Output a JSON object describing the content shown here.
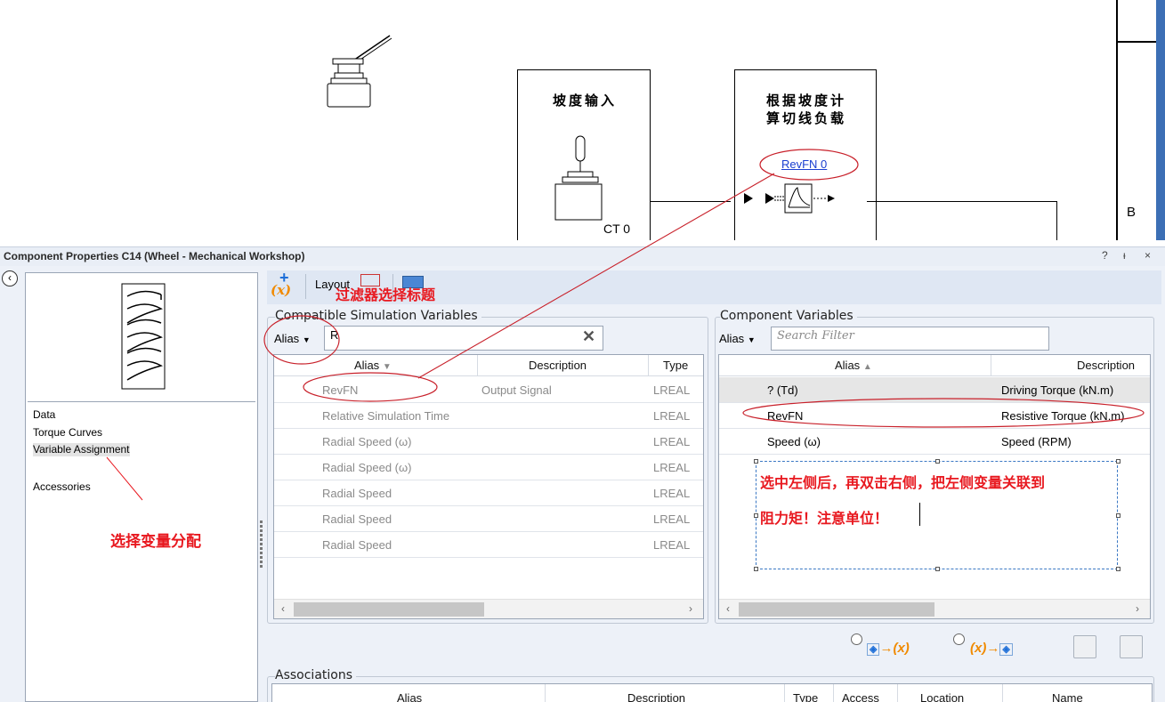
{
  "canvas": {
    "block1": {
      "title": "坡度输入",
      "label": "CT 0"
    },
    "block2": {
      "title_line1": "根据坡度计",
      "title_line2": "算切线负载",
      "link": "RevFN 0"
    },
    "edge_label": "B"
  },
  "window": {
    "title": "Component Properties C14 (Wheel - Mechanical Workshop)",
    "help": "?",
    "pin": "ᵻ",
    "close": "×"
  },
  "nav": {
    "items": [
      {
        "label": "Data"
      },
      {
        "label": "Torque Curves"
      },
      {
        "label": "Variable Assignment",
        "selected": true
      },
      {
        "label": "Accessories"
      }
    ]
  },
  "toolbar": {
    "add_variable_icon": "(x)",
    "layout_label": "Layout"
  },
  "compatible": {
    "group_title": "Compatible Simulation Variables",
    "filter_mode": "Alias",
    "filter_value": "R",
    "columns": {
      "alias": "Alias",
      "description": "Description",
      "type": "Type"
    },
    "rows": [
      {
        "alias": "RevFN",
        "description": "Output Signal",
        "type": "LREAL"
      },
      {
        "alias": "Relative Simulation Time",
        "description": "",
        "type": "LREAL"
      },
      {
        "alias": "Radial Speed (ω)",
        "description": "",
        "type": "LREAL"
      },
      {
        "alias": "Radial Speed (ω)",
        "description": "",
        "type": "LREAL"
      },
      {
        "alias": "Radial Speed",
        "description": "",
        "type": "LREAL"
      },
      {
        "alias": "Radial Speed",
        "description": "",
        "type": "LREAL"
      },
      {
        "alias": "Radial Speed",
        "description": "",
        "type": "LREAL"
      }
    ]
  },
  "component": {
    "group_title": "Component Variables",
    "filter_mode": "Alias",
    "filter_placeholder": "Search Filter",
    "columns": {
      "alias": "Alias",
      "description": "Description"
    },
    "rows": [
      {
        "alias": "? (Td)",
        "description": "Driving Torque (kN.m)"
      },
      {
        "alias": "RevFN",
        "description": "Resistive Torque (kN.m)"
      },
      {
        "alias": "Speed (ω)",
        "description": "Speed (RPM)"
      }
    ]
  },
  "annotations": {
    "filter_title": "过滤器选择标题",
    "select_assignment": "选择变量分配",
    "note_line1": "选中左侧后，再双击右侧，把左侧变量关联到",
    "note_line2": "阻力矩！注意单位！"
  },
  "mapping": {
    "to_variable": "→(x)",
    "to_component": "(x)→"
  },
  "associations": {
    "group_title": "Associations",
    "columns": {
      "alias": "Alias",
      "description": "Description",
      "type": "Type",
      "access": "Access",
      "location": "Location",
      "name": "Name"
    }
  },
  "colors": {
    "annotation": "#e8181f",
    "accent": "#1e6fd8",
    "panel": "#edf1f8"
  }
}
